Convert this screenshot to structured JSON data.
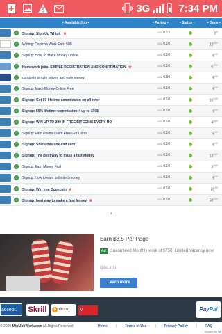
{
  "status_bar": {
    "network": "3G",
    "time": "7:34 PM",
    "left_icons": [
      "notification-plus-icon",
      "gallery-icon",
      "warning-icon",
      "gmail-icon"
    ],
    "right_icons": [
      "vibrate-icon",
      "network-3g-icon",
      "signal-icon",
      "battery-icon"
    ]
  },
  "table": {
    "headers": {
      "available_job": "• Available Job •",
      "paying": "• Paying •",
      "status": "• Status •",
      "done": "• Done •"
    },
    "rows": [
      {
        "title": "Signup: Sign Up Whipir",
        "bold": true,
        "new": true,
        "currency": "USD",
        "paying": "0.15",
        "done": "9",
        "done_sup": "/5"
      },
      {
        "title": "Writing: Captcha Work Earn 500",
        "bold": false,
        "new": false,
        "currency": "USD",
        "paying": "0.10",
        "done": "22",
        "done_sup": "/300"
      },
      {
        "title": "Signup: How To Make Money Online",
        "bold": false,
        "new": false,
        "currency": "USD",
        "paying": "0.10",
        "done": "6",
        "done_sup": "/60"
      },
      {
        "title": "Homework jobs: SIMPLE REGISTRATION AND CONFIRMATION",
        "bold": true,
        "new": true,
        "currency": "USD",
        "paying": "0.10",
        "done": "5",
        "done_sup": "/270"
      },
      {
        "title": "complete simple survey and earn money",
        "bold": false,
        "new": false,
        "currency": "USD",
        "paying": "0.80",
        "done": "5",
        "done_sup": "/60"
      },
      {
        "title": "Signup: Make Money Online Free",
        "bold": false,
        "new": false,
        "currency": "USD",
        "paying": "0.10",
        "done": "5",
        "done_sup": "/60"
      },
      {
        "title": "Signup: Get 50 lifetime commission on all refer",
        "bold": true,
        "new": false,
        "currency": "USD",
        "paying": "0.10",
        "done": "16",
        "done_sup": "/120"
      },
      {
        "title": "Signup: 50% lifetime commission + up to 100$",
        "bold": true,
        "new": false,
        "currency": "USD",
        "paying": "0.10",
        "done": "6",
        "done_sup": "/60"
      },
      {
        "title": "Signup: WIN UP TO 200 IN FREE BITCOINS EVERY HO",
        "bold": true,
        "new": false,
        "currency": "USD",
        "paying": "0.10",
        "done": "4",
        "done_sup": "/300"
      },
      {
        "title": "Signup: Earn Points Claim Free Gift Cards",
        "bold": false,
        "new": false,
        "currency": "USD",
        "paying": "0.10",
        "done": "5",
        "done_sup": "/60"
      },
      {
        "title": "Signup: Share this link and earn",
        "bold": true,
        "new": false,
        "currency": "USD",
        "paying": "0.10",
        "done": "6",
        "done_sup": "/60"
      },
      {
        "title": "Signup: The Best way to make a fast Money",
        "bold": true,
        "new": false,
        "currency": "USD",
        "paying": "0.10",
        "done": "13",
        "done_sup": "/150"
      },
      {
        "title": "Signup: Earn Money Fast",
        "bold": false,
        "new": false,
        "currency": "USD",
        "paying": "0.10",
        "done": "3",
        "done_sup": "/300"
      },
      {
        "title": "Signup: How to earn unlimited money",
        "bold": false,
        "new": false,
        "currency": "USD",
        "paying": "0.10",
        "done": "5",
        "done_sup": "/60"
      },
      {
        "title": "Signup: Win free Dogecoin",
        "bold": true,
        "new": true,
        "currency": "USD",
        "paying": "0.10",
        "done": "28",
        "done_sup": "/50"
      },
      {
        "title": "Signup: best way to make a fast Money",
        "bold": true,
        "new": true,
        "currency": "USD",
        "paying": "0.10",
        "done": "58",
        "done_sup": "/120"
      }
    ],
    "pager": "1"
  },
  "ad": {
    "title": "Earn $3.5 Per Page",
    "tag": "Ad",
    "description": "Guaranteed Monthly work of $750, Limited Vacancy now",
    "url": "cjinc.info",
    "button": "Learn more"
  },
  "payments": {
    "accept": "accept.",
    "skrill": "Skrill",
    "bitcoin": "bitcoin",
    "bitcoin_sub": "ACCEPTED HERE",
    "other": "M",
    "paypal_a": "Pay",
    "paypal_b": "Pal"
  },
  "footer": {
    "copyright_prefix": "© 2020 ",
    "site": "MiniJobWork.com",
    "copyright_suffix": " All Rights Reserved",
    "links": [
      "Home",
      "Terms of Use",
      "Privacy Policy",
      "FAQ"
    ],
    "hosted_by": "Hosted By ",
    "hosted_link": "W"
  },
  "colors": {
    "status_bar": "#ee5a60",
    "table_header": "#2f84c9",
    "ad_button": "#3b7fd0",
    "payment_strip": "#2d3a46"
  }
}
